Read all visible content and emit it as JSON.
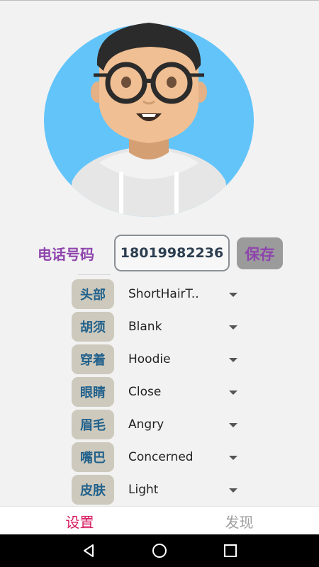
{
  "colors": {
    "accent_purple": "#8e44ad",
    "key_text_blue": "#21618c",
    "key_bg": "#cdc9bc",
    "tab_active": "#d81b60",
    "tab_inactive": "#9e9e9e",
    "avatar_bg": "#63c4fa"
  },
  "avatar": {
    "icon": "avatar-face-icon"
  },
  "phone": {
    "label": "电话号码",
    "value": "18019982236",
    "save_label": "保存"
  },
  "attributes": [
    {
      "key": "头部",
      "value": "ShortHairT.."
    },
    {
      "key": "胡须",
      "value": "Blank"
    },
    {
      "key": "穿着",
      "value": "Hoodie"
    },
    {
      "key": "眼睛",
      "value": "Close"
    },
    {
      "key": "眉毛",
      "value": "Angry"
    },
    {
      "key": "嘴巴",
      "value": "Concerned"
    },
    {
      "key": "皮肤",
      "value": "Light"
    }
  ],
  "tabs": [
    {
      "label": "设置",
      "active": true
    },
    {
      "label": "发现",
      "active": false
    }
  ],
  "nav": [
    "back-icon",
    "home-icon",
    "recents-icon"
  ]
}
